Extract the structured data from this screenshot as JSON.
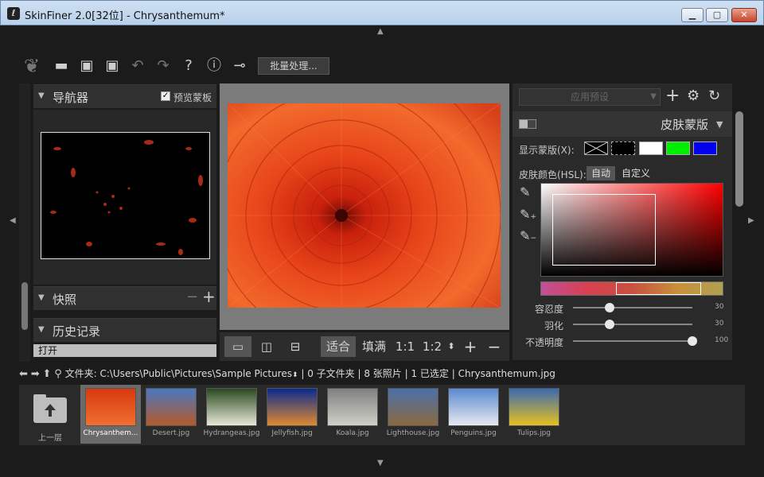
{
  "window": {
    "title": "SkinFiner 2.0[32位] - Chrysanthemum*",
    "app_icon": "feather-icon"
  },
  "toolbar": {
    "icons": [
      "feather-logo-icon",
      "folder-open-icon",
      "save-icon",
      "save-as-icon",
      "undo-icon",
      "redo-icon",
      "help-icon",
      "info-icon",
      "plugin-icon"
    ],
    "batch_label": "批量处理..."
  },
  "navigator": {
    "title": "导航器",
    "preview_checkbox_label": "预览蒙板",
    "preview_checked": true
  },
  "snapshots": {
    "title": "快照"
  },
  "history": {
    "title": "历史记录",
    "items": [
      "打开"
    ]
  },
  "view_bar": {
    "fit": "适合",
    "fill": "填满",
    "zoom1": "1:1",
    "zoom2": "1:2"
  },
  "right_panel": {
    "preset_placeholder": "应用预设",
    "skin_mask_title": "皮肤蒙版",
    "show_mask_label": "显示蒙版(X):",
    "mask_swatches": [
      "#000000",
      "#000000",
      "#ffffff",
      "#00ee00",
      "#0000ee"
    ],
    "skin_color_label": "皮肤颜色(HSL):",
    "auto_label": "自动",
    "custom_label": "自定义",
    "sliders": [
      {
        "label": "容忍度",
        "value": "30",
        "fraction": 0.3
      },
      {
        "label": "羽化",
        "value": "30",
        "fraction": 0.3
      },
      {
        "label": "不透明度",
        "value": "100",
        "fraction": 1.0
      }
    ]
  },
  "path_bar": {
    "folder_label": "文件夹:",
    "path": "C:\\Users\\Public\\Pictures\\Sample Pictures",
    "subfolders": "0 子文件夹",
    "photos": "8 张照片",
    "selected": "1 已选定",
    "current_file": "Chrysanthemum.jpg"
  },
  "filmstrip": {
    "up_label": "上一层",
    "items": [
      {
        "name": "Chrysanthem...",
        "colors": [
          "#d83a10",
          "#f07030"
        ],
        "selected": true
      },
      {
        "name": "Desert.jpg",
        "colors": [
          "#4a78c0",
          "#b45a2a"
        ],
        "selected": false
      },
      {
        "name": "Hydrangeas.jpg",
        "colors": [
          "#2a4a20",
          "#e8e8d8"
        ],
        "selected": false
      },
      {
        "name": "Jellyfish.jpg",
        "colors": [
          "#0a2a90",
          "#e08a30"
        ],
        "selected": false
      },
      {
        "name": "Koala.jpg",
        "colors": [
          "#808080",
          "#d0d0c8"
        ],
        "selected": false
      },
      {
        "name": "Lighthouse.jpg",
        "colors": [
          "#4a70a8",
          "#8a6a40"
        ],
        "selected": false
      },
      {
        "name": "Penguins.jpg",
        "colors": [
          "#5a8ad0",
          "#e8e8f0"
        ],
        "selected": false
      },
      {
        "name": "Tulips.jpg",
        "colors": [
          "#3a6ab0",
          "#e8c020"
        ],
        "selected": false
      }
    ]
  }
}
